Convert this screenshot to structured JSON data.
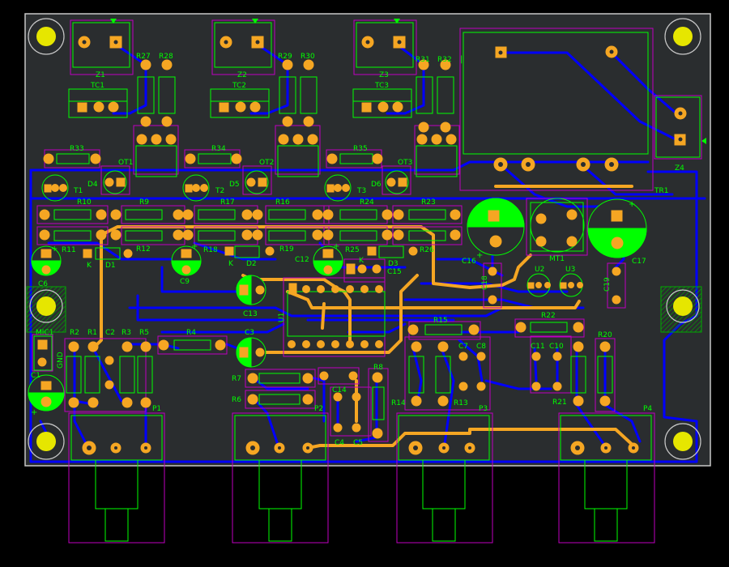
{
  "colors": {
    "background": "#000000",
    "board": "#2a2d2f",
    "outline": "#c8c8c8",
    "silkscreen": "#00ff00",
    "courtyard": "#c000c0",
    "trace_bottom": "#0000ff",
    "trace_top": "#ff9900",
    "pad": "#f5a623",
    "mounting_hole": "#e6e600",
    "hatch": "#00aa00"
  },
  "labels": {
    "Z1": "Z1",
    "Z2": "Z2",
    "Z3": "Z3",
    "Z4": "Z4",
    "TC1": "TC1",
    "TC2": "TC2",
    "TC3": "TC3",
    "R27": "R27",
    "R28": "R28",
    "R29": "R29",
    "R30": "R30",
    "R31": "R31",
    "R32": "R32",
    "R33": "R33",
    "R34": "R34",
    "R35": "R35",
    "OT1": "OT1",
    "OT2": "OT2",
    "OT3": "OT3",
    "D4": "D4",
    "D5": "D5",
    "D6": "D6",
    "T1": "T1",
    "T2": "T2",
    "T3": "T3",
    "TR1": "TR1",
    "R10": "R10",
    "R9": "R9",
    "R17": "R17",
    "R16": "R16",
    "R24": "R24",
    "R23": "R23",
    "R11": "R11",
    "R12": "R12",
    "R18": "R18",
    "R19": "R19",
    "R25": "R25",
    "R26": "R26",
    "K1": "K",
    "K2": "K",
    "K3": "K",
    "D1": "D1",
    "D2": "D2",
    "D3": "D3",
    "C6": "C6",
    "C9": "C9",
    "C12": "C12",
    "C15": "C15",
    "C13": "C13",
    "C16": "C16",
    "C17": "C17",
    "C18": "C18",
    "C19": "C19",
    "MT1": "MT1",
    "U2": "U2",
    "U3": "U3",
    "U1": "U1",
    "MIC1": "MIC1",
    "GND": "GND",
    "R2": "R2",
    "R1": "R1",
    "C2": "C2",
    "R3": "R3",
    "R5": "R5",
    "R4": "R4",
    "C3": "C3",
    "C1": "C1",
    "R7": "R7",
    "R6": "R6",
    "R8": "R8",
    "C14": "C14",
    "C4": "C4",
    "C5": "C5",
    "R15": "R15",
    "C7": "C7",
    "C8": "C8",
    "R14": "R14",
    "R13": "R13",
    "R22": "R22",
    "C11": "C11",
    "C10": "C10",
    "R20": "R20",
    "R21": "R21",
    "P1": "P1",
    "P2": "P2",
    "P3": "P3",
    "P4": "P4"
  }
}
